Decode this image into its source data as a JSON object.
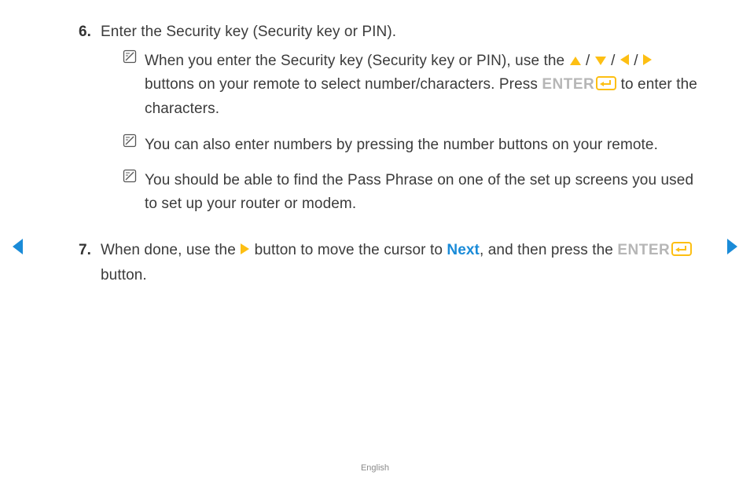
{
  "steps": [
    {
      "n": "6.",
      "head": "Enter the Security key (Security key or PIN).",
      "notes": [
        {
          "pre": "When you enter the Security key (Security key or PIN), use the ",
          "mid": " buttons on your remote to select number/characters. Press ",
          "enter": "ENTER",
          "post": " to enter the characters."
        },
        {
          "plain": "You can also enter numbers by pressing the number buttons on your remote."
        },
        {
          "plain": "You should be able to find the Pass Phrase on one of the set up screens you used to set up your router or modem."
        }
      ]
    },
    {
      "n": "7.",
      "a": "When done, use the ",
      "b": " button to move the cursor to ",
      "next": "Next",
      "c": ", and then press the ",
      "enter": "ENTER",
      "d": " button."
    }
  ],
  "sep": " / ",
  "footer": "English"
}
